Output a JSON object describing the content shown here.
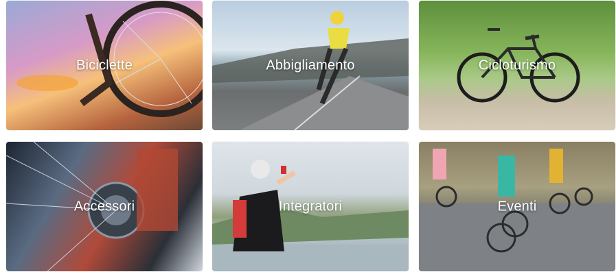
{
  "categories": [
    {
      "label": "Biciclette"
    },
    {
      "label": "Abbigliamento"
    },
    {
      "label": "Cicloturismo"
    },
    {
      "label": "Accessori"
    },
    {
      "label": "Integratori"
    },
    {
      "label": "Eventi"
    }
  ]
}
